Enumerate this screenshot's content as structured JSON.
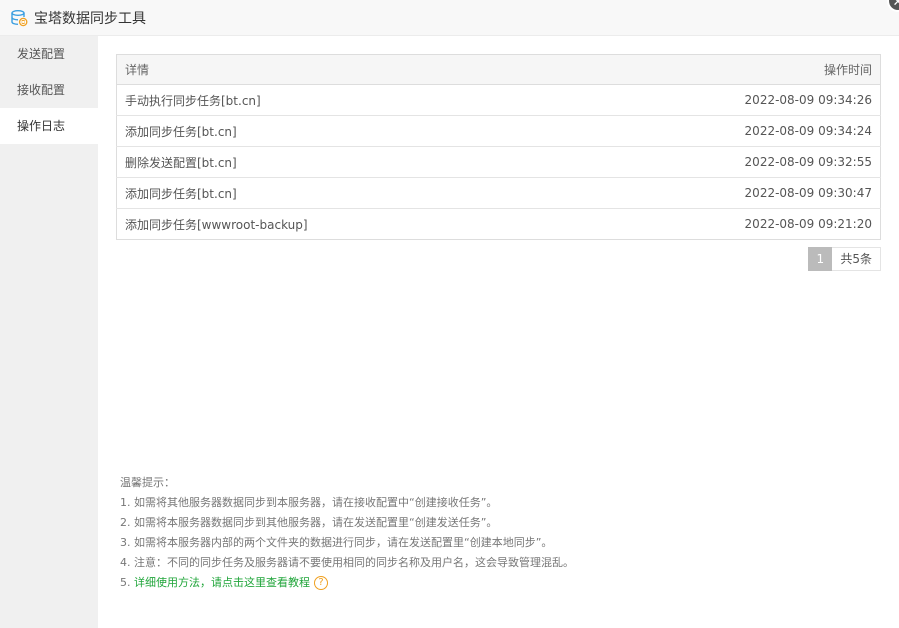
{
  "window": {
    "title": "宝塔数据同步工具",
    "close_icon": "✕"
  },
  "sidebar": {
    "items": [
      {
        "label": "发送配置"
      },
      {
        "label": "接收配置"
      },
      {
        "label": "操作日志"
      }
    ],
    "active_index": 2
  },
  "log_table": {
    "headers": {
      "detail": "详情",
      "time": "操作时间"
    },
    "rows": [
      {
        "detail": "手动执行同步任务[bt.cn]",
        "time": "2022-08-09 09:34:26"
      },
      {
        "detail": "添加同步任务[bt.cn]",
        "time": "2022-08-09 09:34:24"
      },
      {
        "detail": "删除发送配置[bt.cn]",
        "time": "2022-08-09 09:32:55"
      },
      {
        "detail": "添加同步任务[bt.cn]",
        "time": "2022-08-09 09:30:47"
      },
      {
        "detail": "添加同步任务[wwwroot-backup]",
        "time": "2022-08-09 09:21:20"
      }
    ]
  },
  "pager": {
    "current_page": "1",
    "total": "共5条"
  },
  "tips": {
    "heading": "温馨提示：",
    "lines": [
      "1. 如需将其他服务器数据同步到本服务器，请在接收配置中“创建接收任务”。",
      "2. 如需将本服务器数据同步到其他服务器，请在发送配置里“创建发送任务”。",
      "3. 如需将本服务器内部的两个文件夹的数据进行同步，请在发送配置里“创建本地同步”。",
      "4. 注意：不同的同步任务及服务器请不要使用相同的同步名称及用户名，这会导致管理混乱。"
    ],
    "link_prefix": "5. ",
    "link_text": "详细使用方法，请点击这里查看教程",
    "help_icon": "?"
  },
  "colors": {
    "accent_green": "#20a53a",
    "help_orange": "#f0a020",
    "sidebar_bg": "#f0f0f0"
  }
}
